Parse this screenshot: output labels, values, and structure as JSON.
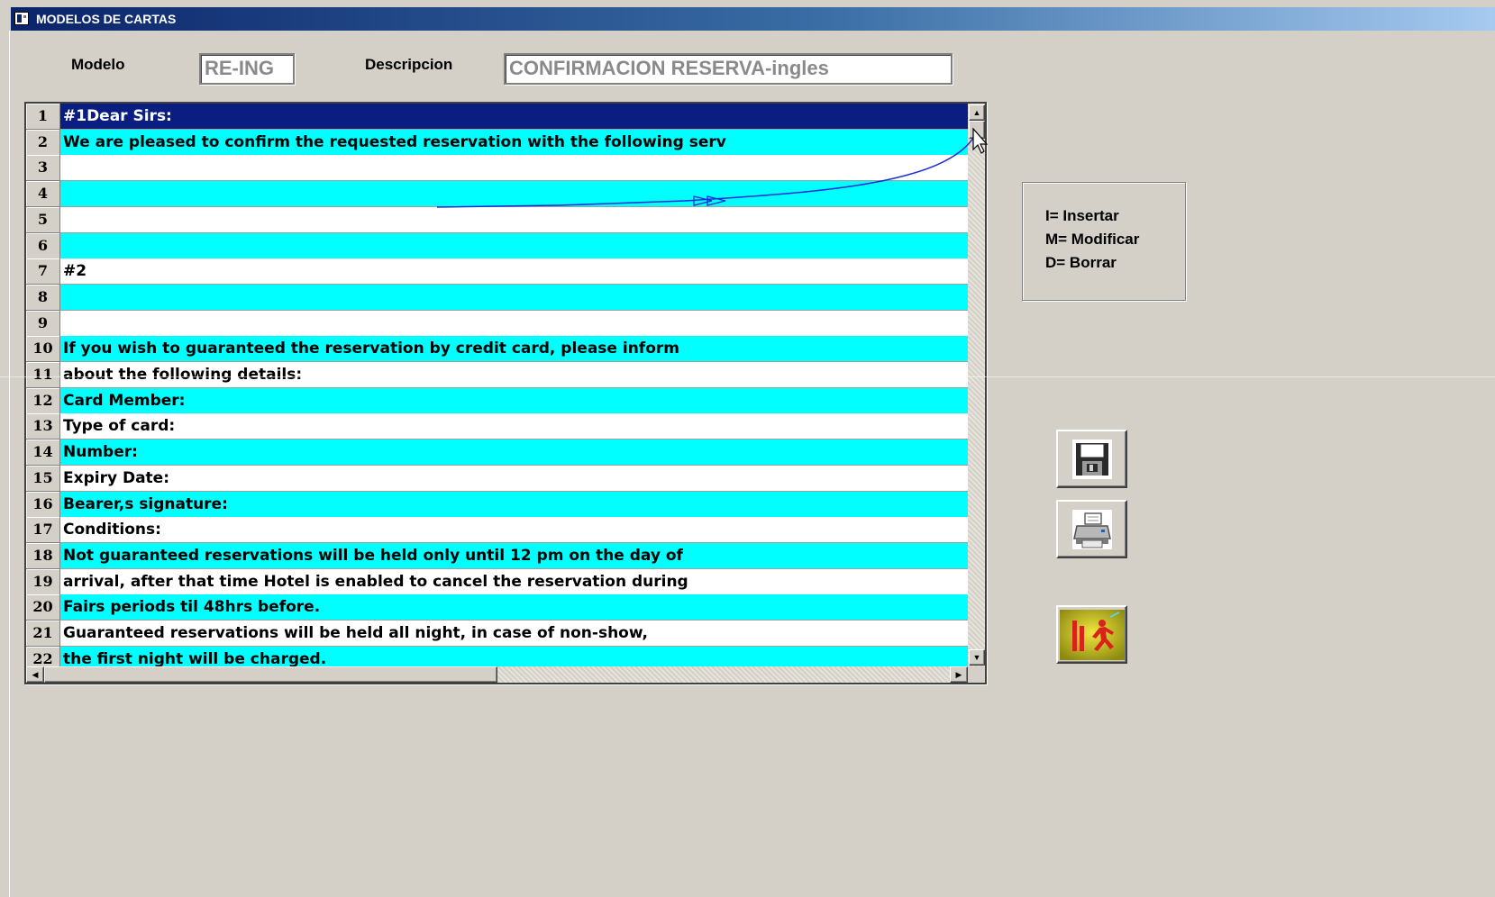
{
  "window": {
    "title": "MODELOS DE CARTAS",
    "icon": "app-icon"
  },
  "form": {
    "modelo_label": "Modelo",
    "modelo_value": "RE-ING",
    "descripcion_label": "Descripcion",
    "descripcion_value": "CONFIRMACION RESERVA-ingles"
  },
  "grid": {
    "rows": [
      {
        "num": "1",
        "text": "#1Dear Sirs:"
      },
      {
        "num": "2",
        "text": "We are pleased to confirm the requested reservation with the following serv"
      },
      {
        "num": "3",
        "text": ""
      },
      {
        "num": "4",
        "text": ""
      },
      {
        "num": "5",
        "text": ""
      },
      {
        "num": "6",
        "text": ""
      },
      {
        "num": "7",
        "text": "#2"
      },
      {
        "num": "8",
        "text": ""
      },
      {
        "num": "9",
        "text": ""
      },
      {
        "num": "10",
        "text": "If you wish to guaranteed the reservation by credit card, please inform"
      },
      {
        "num": "11",
        "text": "about the following details:"
      },
      {
        "num": "12",
        "text": "Card Member:"
      },
      {
        "num": "13",
        "text": "Type of card:"
      },
      {
        "num": "14",
        "text": "Number:"
      },
      {
        "num": "15",
        "text": "Expiry Date:"
      },
      {
        "num": "16",
        "text": "Bearer,s signature:"
      },
      {
        "num": "17",
        "text": "Conditions:"
      },
      {
        "num": "18",
        "text": "Not guaranteed reservations will be held only until 12 pm on the day of"
      },
      {
        "num": "19",
        "text": "arrival, after that time Hotel is enabled to cancel the reservation during"
      },
      {
        "num": "20",
        "text": "Fairs periods til 48hrs before."
      },
      {
        "num": "21",
        "text": "Guaranteed reservations will be held all night, in case of non-show,"
      },
      {
        "num": "22",
        "text": "the first night will be charged."
      }
    ],
    "selected_row": 1
  },
  "scrollbars": {
    "up_glyph": "▲",
    "down_glyph": "▼",
    "left_glyph": "◀",
    "right_glyph": "▶"
  },
  "legend": {
    "insert": "I= Insertar",
    "modify": "M= Modificar",
    "delete": "D= Borrar"
  },
  "toolbar": {
    "save_icon": "floppy-disk-icon",
    "print_icon": "printer-icon",
    "exit_icon": "exit-door-icon"
  },
  "colors": {
    "row_alt": "#00ffff",
    "row_base": "#ffffff",
    "selected": "#0a1e82",
    "exit_button_bg": "#d6c800"
  }
}
